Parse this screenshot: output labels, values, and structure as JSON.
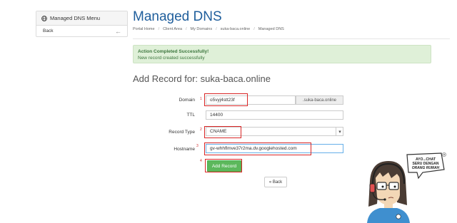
{
  "sidebar": {
    "header": "Managed DNS Menu",
    "back_label": "Back",
    "back_arrow": "←"
  },
  "page": {
    "title": "Managed DNS",
    "breadcrumb": [
      "Portal Home",
      "Client Area",
      "My Domains",
      "suka-baca.online",
      "Managed DNS"
    ],
    "breadcrumb_sep": "/"
  },
  "alert": {
    "title": "Action Completed Successfully!",
    "message": "New record created successfully"
  },
  "form": {
    "heading": "Add Record for: suka-baca.online",
    "domain_label": "Domain",
    "domain_value": "o5vyj4stt23f",
    "domain_suffix": ".suka-baca.online",
    "ttl_label": "TTL",
    "ttl_value": "14400",
    "record_type_label": "Record Type",
    "record_type_value": "CNAME",
    "hostname_label": "Hostname",
    "hostname_value": "gv-whhflmve37r2ma.dv.googlehosted.com",
    "add_button": "Add Record",
    "back_button": "« Back",
    "markers": [
      "1",
      "2",
      "3",
      "4"
    ]
  },
  "mascot": {
    "speech_lines": [
      "AYO...CHAT",
      "SERU DENGAN",
      "ORANG RUMAH"
    ]
  },
  "colors": {
    "title_blue": "#1f5e9c",
    "alert_bg": "#dff0d8",
    "alert_text": "#3c763d",
    "button_green": "#5cb85c",
    "highlight_red": "#d92626"
  },
  "icons": {
    "sidebar_header": "globe-icon",
    "back": "arrow-left-icon",
    "select": "chevron-down-icon"
  }
}
